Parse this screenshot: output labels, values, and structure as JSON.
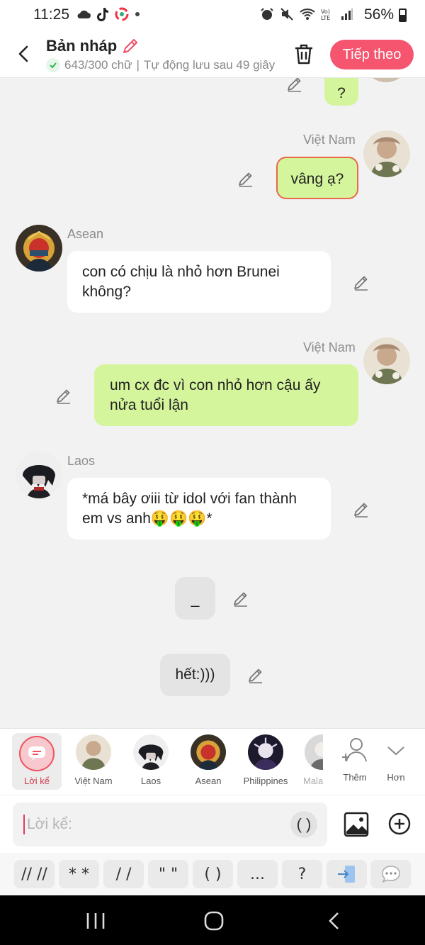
{
  "status": {
    "time": "11:25",
    "battery": "56%"
  },
  "header": {
    "title": "Bản nháp",
    "word_count": "643/300 chữ",
    "autosave": "Tự động lưu sau 49 giây",
    "next_label": "Tiếp theo"
  },
  "messages": [
    {
      "side": "right",
      "text": "?"
    },
    {
      "side": "right",
      "sender": "Việt Nam",
      "text": "vâng ạ?"
    },
    {
      "side": "left",
      "sender": "Asean",
      "text": "con có chịu là nhỏ hơn Brunei không?"
    },
    {
      "side": "right",
      "sender": "Việt Nam",
      "text": "um cx đc vì con nhỏ hơn cậu ấy nửa tuổi lận"
    },
    {
      "side": "left",
      "sender": "Laos",
      "text": "*má bây ơiii từ idol với fan thành em vs anh🤑🤑🤑*"
    },
    {
      "side": "narration",
      "text": "_"
    },
    {
      "side": "narration",
      "text": "hết:)))"
    }
  ],
  "characters": {
    "narration_label": "Lời kể",
    "items": [
      "Việt Nam",
      "Laos",
      "Asean",
      "Philippines",
      "Malaysia"
    ],
    "more_label": "Thêm",
    "less_label": "Hơn"
  },
  "input": {
    "placeholder": "Lời kể:",
    "paren": "( )"
  },
  "symbols": [
    "// //",
    "* *",
    "/ /",
    "\" \"",
    "( )",
    "...",
    "?"
  ],
  "colors": {
    "accent": "#f5556f",
    "bubble_right": "#d4f59b",
    "bubble_left": "#ffffff",
    "narration": "#e4e4e4"
  }
}
